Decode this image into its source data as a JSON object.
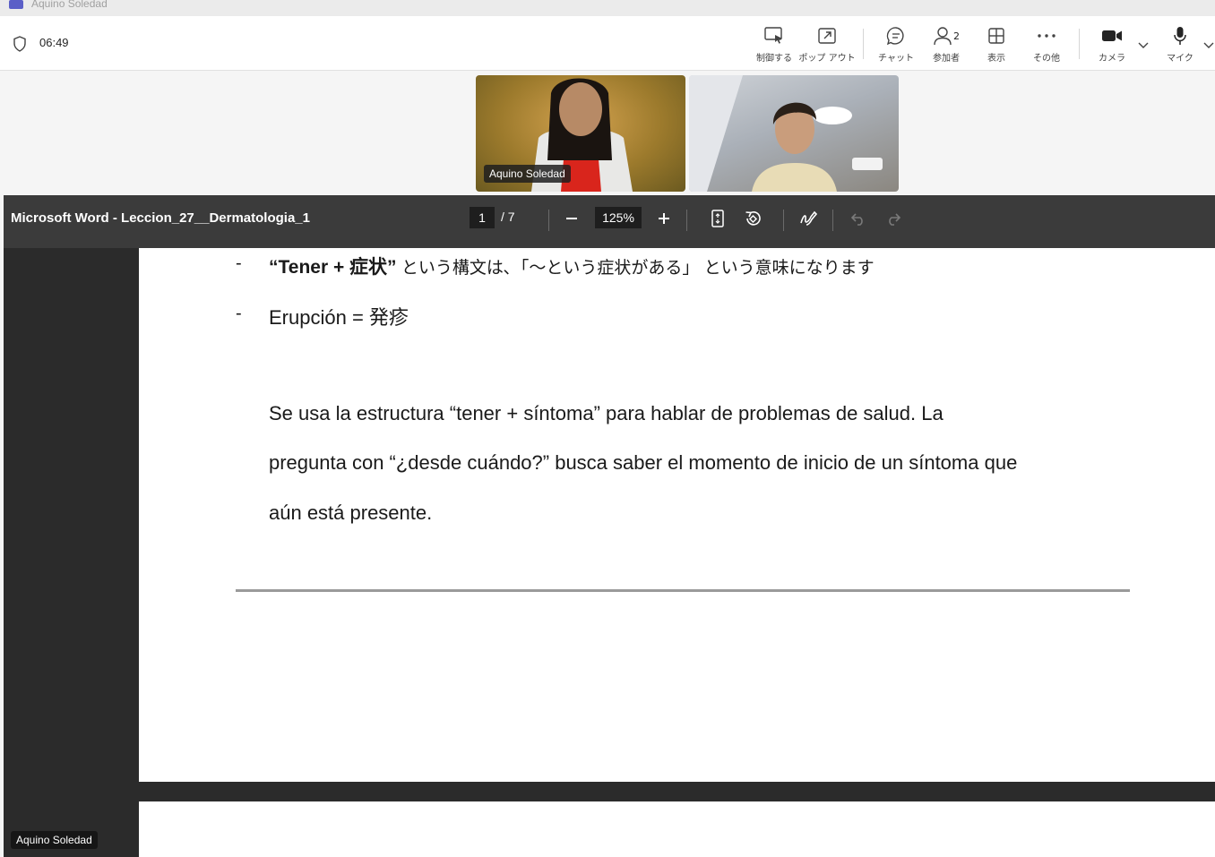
{
  "window": {
    "title": "Aquino Soledad"
  },
  "meeting": {
    "timer": "06:49",
    "toolbar": {
      "control_label": "制御する",
      "popout_label": "ポップ アウト",
      "chat_label": "チャット",
      "people_label": "参加者",
      "people_count": "2",
      "view_label": "表示",
      "more_label": "その他",
      "camera_label": "カメラ",
      "mic_label": "マイク"
    }
  },
  "participants": [
    {
      "name": "Aquino Soledad"
    },
    {
      "name": ""
    }
  ],
  "viewer": {
    "title": "Microsoft Word - Leccion_27__Dermatologia_1",
    "page_current": "1",
    "page_total": "/ 7",
    "zoom": "125%"
  },
  "document": {
    "bullets": [
      {
        "marker": "-",
        "bold": "“Tener + 症状”",
        "text": " という構文は､「〜という症状がある」 という意味になります"
      },
      {
        "marker": "-",
        "bold": "",
        "text": "Erupción = 発疹"
      }
    ],
    "paragraph_lines": [
      "Se usa la estructura “tener + síntoma” para hablar de problemas de salud. La",
      "pregunta con “¿desde cuándo?” busca saber el momento de inicio de un síntoma que",
      "aún está presente."
    ]
  },
  "presenter_label": "Aquino Soledad",
  "colors": {
    "accent": "#5b5fc7",
    "viewer_bg": "#2b2b2b",
    "viewer_bar": "#3b3b3b"
  }
}
